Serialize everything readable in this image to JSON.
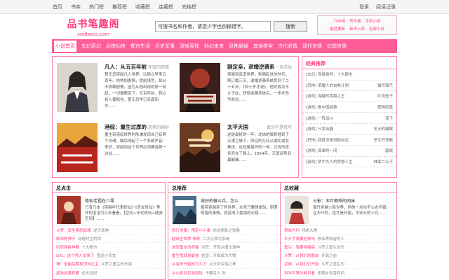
{
  "topnav": [
    "首页",
    "书库",
    "热门榜",
    "推荐榜",
    "收藏榜",
    "连载榜",
    "完结榜"
  ],
  "toplinks": [
    "登录",
    "阅读记录"
  ],
  "logo": {
    "title": "品书笔趣阁",
    "domain": "vodtwxs.com"
  },
  "search": {
    "value": "可搜书名和作者，请您少字也别输错字。",
    "button": "搜索"
  },
  "quick_links": {
    "row1": [
      "TOP榜",
      "写作榜",
      "手机小说"
    ],
    "row2": [
      "最近更新",
      "新书入库",
      "全部小说"
    ]
  },
  "mainnav": [
    "小说首页",
    "玄幻奇幻",
    "武侠仙侠",
    "都市生活",
    "历史军事",
    "游戏竞技",
    "科幻未来",
    "恐怖悬疑",
    "其他类型",
    "古代言情",
    "现代言情",
    "幻想言情"
  ],
  "featured": [
    {
      "title": "凡人：从五百年前",
      "author": "年轻的西楼",
      "desc": "楚无忌穿越凡人世界，比韩立早来五百年。他熟知剧情，提前谋划，却从不依赖剧情，因为从他出现的那一刻起，一切便都变了。五百年前，韩立初入黄枫谷，楚无忌早已名震四方……",
      "cover": "portrait"
    },
    {
      "title": "刚定亲，退婚逆袭系",
      "author": "一世成仙",
      "desc": "穿越到武道世界，秋隔乱世的时代。刚订婚三天，退婚逆袭系统竟到了二十五年。《四十岁才说》，他的成功不止于此，获得逆袭系统后，一步步改写命运……",
      "cover": "title1"
    },
    {
      "title": "港综：重生过厚的",
      "author": "恐怖的蝌蚪",
      "desc": "重生到港综世界的陈谦发现自己有两个灵魂。脑后响起了一个系统声音：李好，穿越到这个世界必须要选择一边站……",
      "cover": "title2"
    },
    {
      "title": "太平天国",
      "author": "真的不是我写",
      "desc": "这是最好的一年，北纬的旗帜插到了天津卫城下，西征的万队从湖北湖北推进，这也是最坏的一年，北伐的官兵死在了路上。1854年，天国运势到最巅峰……",
      "cover": "title3"
    }
  ],
  "side": {
    "title": "经典推荐",
    "items": [
      {
        "book": "[玄幻] 穿越诡异，十大都市",
        "author": ""
      },
      {
        "book": "[恐怖] 荣耀人的自救计划",
        "author": "猫爷镇气"
      },
      {
        "book": "[游戏] 海贼的黄猿之王",
        "author": "红烧鱼干"
      },
      {
        "book": "[游戏] 看中国搞事",
        "author": "肥狗同盖"
      },
      {
        "book": "[游戏] 一阵战斗",
        "author": "漫子"
      },
      {
        "book": "[游戏] 只卖仙器",
        "author": "冬天的蝴蝶"
      },
      {
        "book": "[恐怖] 我真没想进那凶宅",
        "author": "举手开宫殿"
      },
      {
        "book": "[游戏] 简单的一间",
        "author": "罂绒"
      },
      {
        "book": "[游戏] 梦中大人的梦想人生",
        "author": "林家二公子"
      }
    ]
  },
  "rankings": [
    {
      "heading": "总点击",
      "top_title": "修仙老祖在八零",
      "top_desc": "已有乃本《穿越年代来修仙》《农女修仙》等作的宝宝可以去看看。【空间+年代修仙+随身空间】……",
      "items": [
        {
          "a": "斗罗：双生禁忌武魂",
          "b": "逆天武神"
        },
        {
          "a": "终末的神子",
          "b": "穿越时空的剑"
        },
        {
          "a": "时空穿梭神殿",
          "b": "十大都市"
        },
        {
          "a": "LOL：这个男人太强了",
          "b": "团宠小农女"
        },
        {
          "a": "神！全能站期和顶流正主",
          "b": "斗罗之重生的光强"
        },
        {
          "a": "星际逆袭称霸",
          "b": "逆天狂妃"
        }
      ]
    },
    {
      "heading": "总推荐",
      "top_title": "说好的做斗兵，怎么",
      "top_desc": "姜芙穿越到了异世界，本来只要想体验。阴差阳错的事情，就变成了最强的天赋……",
      "items": [
        {
          "a": "修行逆袭：预定小小妻",
          "b": "命运倒影之较量"
        },
        {
          "a": "超级全世界 神奇",
          "b": "二次元黄毛系统"
        },
        {
          "a": "逆流重生的青春",
          "b": "洪荒：开局从魔法演神"
        },
        {
          "a": "重生我就是最强",
          "b": "吞兽：开局成为大锅"
        },
        {
          "a": "从海天开始成为大力",
          "b": "从天到深海之神"
        },
        {
          "a": "从火影到打到冒险",
          "b": "干翻名人 你"
        }
      ]
    },
    {
      "heading": "总收藏",
      "top_title": "火影：木叶卿乖的同床",
      "top_desc": "夏丹穿越火影世界，但他一点也不心态不错。在木叶村，这才是开始，不安分的人们……",
      "items": [
        {
          "a": "师妹为何",
          "b": "扬帆大男"
        },
        {
          "a": "不分手就要这样吗",
          "b": "修仙界收留的人"
        },
        {
          "a": "重生：我要穿越高",
          "b": "斗罗之重生的光"
        },
        {
          "a": "斗罗：从我们的朋友",
          "b": "开局之前"
        },
        {
          "a": "龙族：从我们们开始",
          "b": "斗罗之重生的"
        },
        {
          "a": "科学世界的救世者",
          "b": "宋朝乡圣雪宾西"
        }
      ]
    }
  ],
  "colors": {
    "accent": "#ff3b7f",
    "nav": "#ff5d98",
    "border": "#ff80b0"
  }
}
